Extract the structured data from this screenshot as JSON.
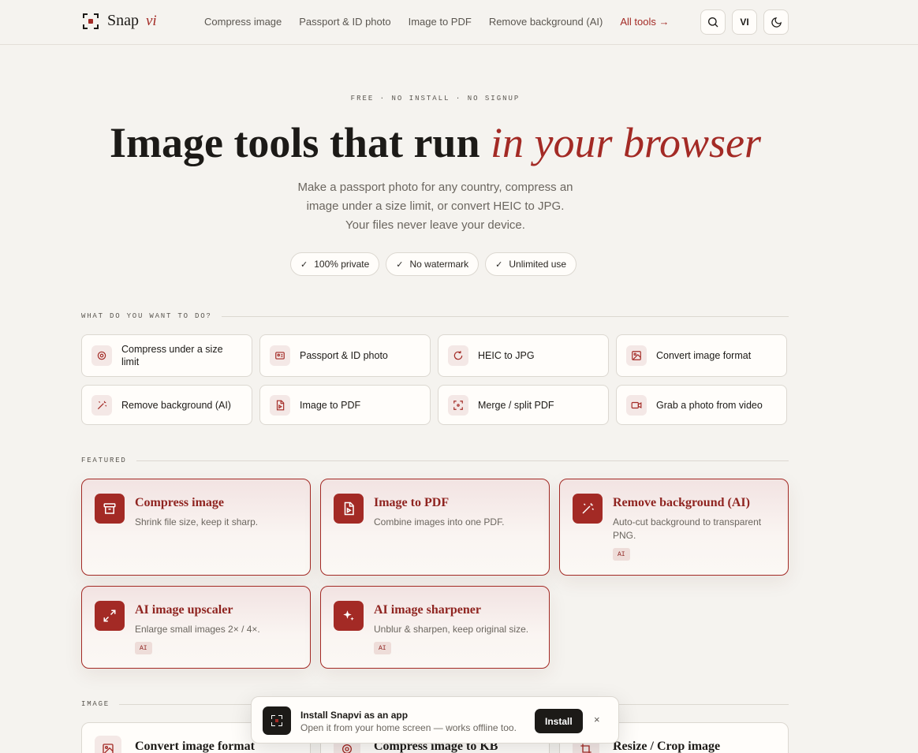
{
  "header": {
    "logo_text": "Snap",
    "logo_accent": "vi",
    "nav": [
      "Compress image",
      "Passport & ID photo",
      "Image to PDF",
      "Remove background (AI)"
    ],
    "all_tools": "All tools →",
    "lang": "VI"
  },
  "hero": {
    "eyebrow": "FREE · NO INSTALL · NO SIGNUP",
    "title_main": "Image tools that run ",
    "title_accent": "in your browser",
    "subtitle": "Make a passport photo for any country, compress an image under a size limit, or convert HEIC to JPG. Your files never leave your device.",
    "badges": [
      "100% private",
      "No watermark",
      "Unlimited use"
    ]
  },
  "quick": {
    "label": "WHAT DO YOU WANT TO DO?",
    "items": [
      {
        "label": "Compress under a size limit",
        "icon": "target-icon"
      },
      {
        "label": "Passport & ID photo",
        "icon": "id-card-icon"
      },
      {
        "label": "HEIC to JPG",
        "icon": "refresh-icon"
      },
      {
        "label": "Convert image format",
        "icon": "image-icon"
      },
      {
        "label": "Remove background (AI)",
        "icon": "magic-wand-icon"
      },
      {
        "label": "Image to PDF",
        "icon": "pdf-file-icon"
      },
      {
        "label": "Merge / split PDF",
        "icon": "merge-icon"
      },
      {
        "label": "Grab a photo from video",
        "icon": "video-icon"
      }
    ]
  },
  "featured": {
    "label": "FEATURED",
    "cards": [
      {
        "title": "Compress image",
        "desc": "Shrink file size, keep it sharp.",
        "tag": "",
        "icon": "archive-icon"
      },
      {
        "title": "Image to PDF",
        "desc": "Combine images into one PDF.",
        "tag": "",
        "icon": "pdf-file-icon"
      },
      {
        "title": "Remove background (AI)",
        "desc": "Auto-cut background to transparent PNG.",
        "tag": "AI",
        "icon": "magic-wand-icon"
      },
      {
        "title": "AI image upscaler",
        "desc": "Enlarge small images 2× / 4×.",
        "tag": "AI",
        "icon": "expand-icon"
      },
      {
        "title": "AI image sharpener",
        "desc": "Unblur & sharpen, keep original size.",
        "tag": "AI",
        "icon": "sparkle-icon"
      }
    ]
  },
  "image_section": {
    "label": "IMAGE",
    "cards": [
      "Convert image format",
      "Compress image to KB",
      "Resize / Crop image"
    ]
  },
  "toast": {
    "title": "Install Snapvi as an app",
    "subtitle": "Open it from your home screen — works offline too.",
    "button": "Install",
    "close": "×"
  },
  "colors": {
    "accent": "#a32a25",
    "background": "#f5f3ef",
    "text": "#1c1a17"
  }
}
